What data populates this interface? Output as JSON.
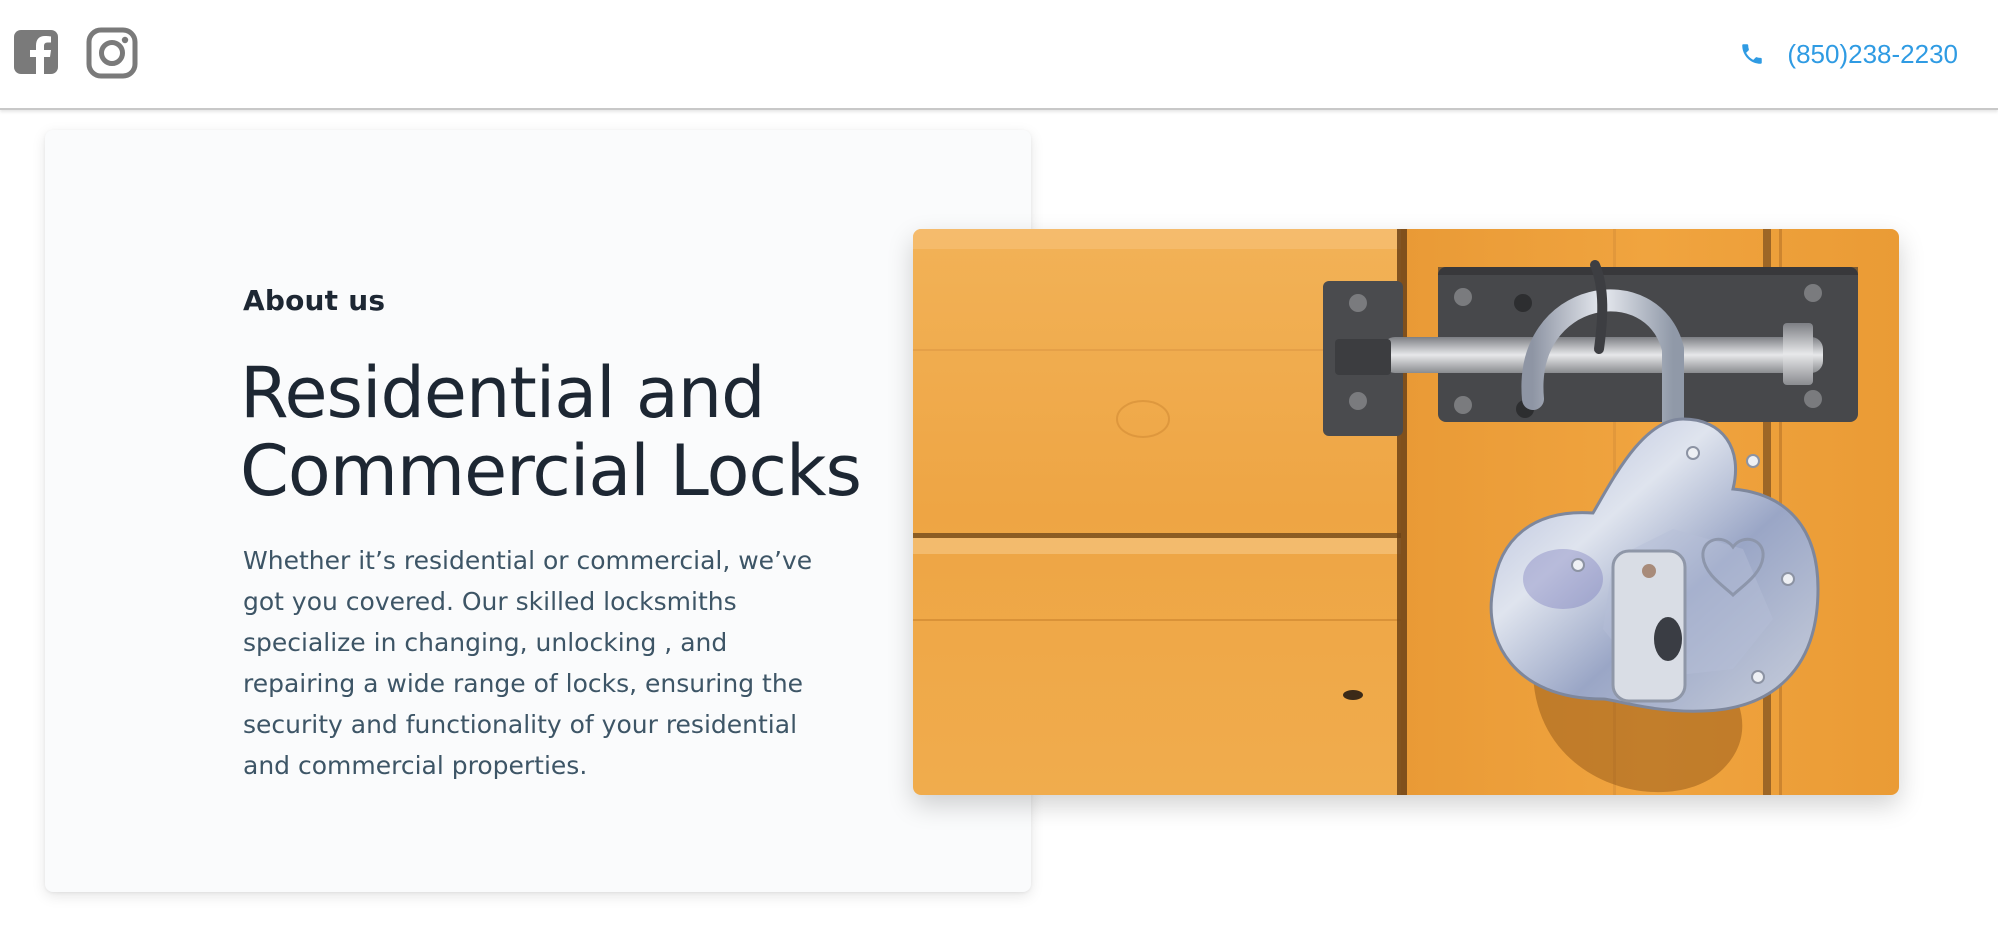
{
  "header": {
    "social": [
      {
        "name": "facebook",
        "icon": "facebook-icon",
        "color": "#7a7a7a"
      },
      {
        "name": "instagram",
        "icon": "instagram-icon",
        "color": "#7a7a7a"
      }
    ],
    "phone": {
      "icon": "phone-icon",
      "number": "(850)238-2230",
      "color": "#2f9be3"
    }
  },
  "about": {
    "eyebrow": "About us",
    "headline_line1": "Residential and",
    "headline_line2": "Commercial Locks",
    "body": "Whether it’s residential or commercial, we’ve got you covered. Our skilled locksmiths specialize in changing, unlocking , and repairing a wide range of locks, ensuring the security and functionality of your residential and commercial properties."
  },
  "image": {
    "subject": "padlock on yellow wooden door latch"
  },
  "colors": {
    "heading": "#1d2733",
    "body": "#3d5566",
    "accent": "#2f9be3",
    "wood": "#f0a83a"
  }
}
